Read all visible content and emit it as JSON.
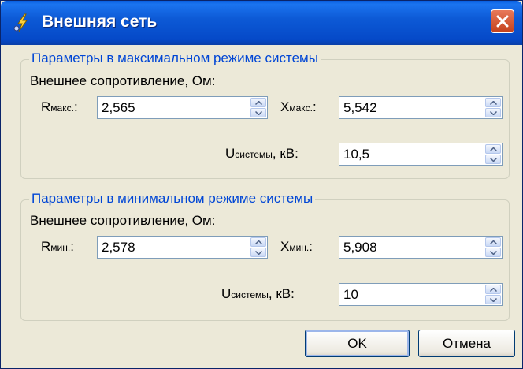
{
  "window": {
    "title": "Внешняя сеть"
  },
  "max_group": {
    "legend": "Параметры в максимальном режиме системы",
    "resistance_label": "Внешнее сопротивление, Ом:",
    "r_main": "R",
    "r_sub": "макс.",
    "r_colon": ":",
    "r_value": "2,565",
    "x_main": "X",
    "x_sub": "макс.",
    "x_colon": ":",
    "x_value": "5,542",
    "u_main": "U",
    "u_sub": "системы",
    "u_tail": ", кВ:",
    "u_value": "10,5"
  },
  "min_group": {
    "legend": "Параметры в минимальном режиме системы",
    "resistance_label": "Внешнее сопротивление, Ом:",
    "r_main": "R",
    "r_sub": "мин.",
    "r_colon": ":",
    "r_value": "2,578",
    "x_main": "X",
    "x_sub": "мин.",
    "x_colon": ":",
    "x_value": "5,908",
    "u_main": "U",
    "u_sub": "системы",
    "u_tail": ", кВ:",
    "u_value": "10"
  },
  "buttons": {
    "ok": "OK",
    "cancel": "Отмена"
  },
  "icons": {
    "title": "lightning-tool-icon",
    "close": "close-icon",
    "spin_up": "spin-up-icon",
    "spin_down": "spin-down-icon"
  },
  "colors": {
    "titlebar": "#0549c8",
    "legend_text": "#0046d5",
    "dialog_bg": "#ece9d8",
    "close_button": "#c3411d"
  }
}
